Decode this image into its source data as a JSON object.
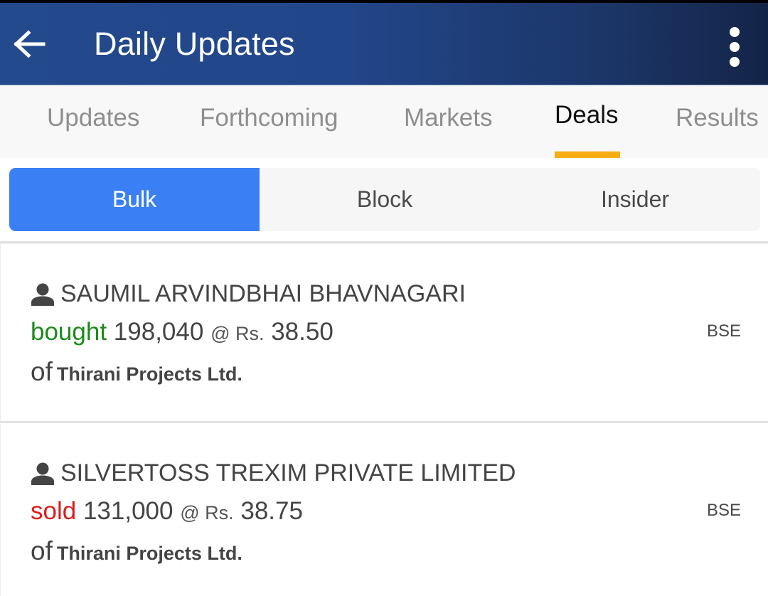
{
  "appbar": {
    "title": "Daily Updates",
    "back_icon": "arrow-left-icon",
    "menu_icon": "more-vertical-icon"
  },
  "tabs": [
    {
      "label": "Updates",
      "active": false
    },
    {
      "label": "Forthcoming",
      "active": false
    },
    {
      "label": "Markets",
      "active": false
    },
    {
      "label": "Deals",
      "active": true
    },
    {
      "label": "Results",
      "active": false
    }
  ],
  "segments": [
    {
      "label": "Bulk",
      "active": true
    },
    {
      "label": "Block",
      "active": false
    },
    {
      "label": "Insider",
      "active": false
    }
  ],
  "deals": [
    {
      "person_icon": "person-icon",
      "party": "SAUMIL ARVINDBHAI BHAVNAGARI",
      "action": "bought",
      "quantity": "198,040",
      "at_label": "@ Rs.",
      "price": "38.50",
      "of_label": "of",
      "company": "Thirani Projects Ltd.",
      "exchange": "BSE"
    },
    {
      "person_icon": "person-icon",
      "party": "SILVERTOSS TREXIM PRIVATE LIMITED",
      "action": "sold",
      "quantity": "131,000",
      "at_label": "@ Rs.",
      "price": "38.75",
      "of_label": "of",
      "company": "Thirani Projects Ltd.",
      "exchange": "BSE"
    }
  ],
  "colors": {
    "appbar": "#234a8c",
    "tab_indicator": "#f6ad12",
    "segment_active": "#3a80f4",
    "bought": "#1a8a1a",
    "sold": "#e01b1b"
  }
}
